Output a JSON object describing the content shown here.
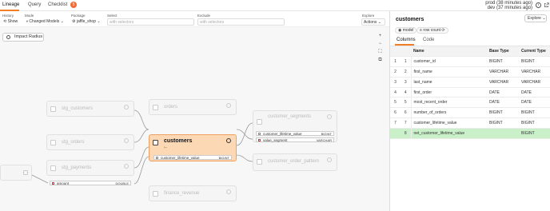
{
  "tabs": [
    "Lineage",
    "Query",
    "Checklist"
  ],
  "checklist_count": "5",
  "env": {
    "prod": "prod (38 minutes ago)",
    "dev": "dev (37 minutes ago)"
  },
  "filters": {
    "history_label": "History",
    "history_value": "Show",
    "mode_label": "Mode",
    "mode_value": "Changed Models",
    "package_label": "Package",
    "package_value": "jaffle_shop",
    "select_label": "Select",
    "select_placeholder": "with selectors",
    "exclude_label": "Exclude",
    "exclude_placeholder": "with selectors",
    "explore_label": "Explore",
    "actions_value": "Actions"
  },
  "graph": {
    "impact_radius": "Impact Radius",
    "nodes": {
      "stg_customers": "stg_customers",
      "stg_orders": "stg_orders",
      "stg_payments": "stg_payments",
      "orders": "orders",
      "customers": "customers",
      "finance_revenue": "finance_revenue",
      "customer_segments": "customer_segments",
      "customer_order_pattern": "customer_order_pattern"
    },
    "columns": {
      "amount": {
        "name": "amount",
        "type": "DOUBLE"
      },
      "customers_clv": {
        "name": "customer_lifetime_value",
        "type": "BIGINT"
      },
      "seg_clv": {
        "name": "customer_lifetime_value",
        "type": "BIGINT"
      },
      "seg_value": {
        "name": "value_segment",
        "type": "VARCHAR"
      }
    }
  },
  "panel": {
    "title": "customers",
    "explore": "Explore",
    "pill_model": "model",
    "pill_rowcount": "row count",
    "tab_columns": "Columns",
    "tab_code": "Code",
    "headers": [
      "",
      "",
      "Name",
      "Base Type",
      "Current Type"
    ],
    "rows": [
      {
        "i": "1",
        "j": "1",
        "name": "customer_id",
        "base": "BIGINT",
        "cur": "BIGINT"
      },
      {
        "i": "2",
        "j": "2",
        "name": "first_name",
        "base": "VARCHAR",
        "cur": "VARCHAR"
      },
      {
        "i": "3",
        "j": "3",
        "name": "last_name",
        "base": "VARCHAR",
        "cur": "VARCHAR"
      },
      {
        "i": "4",
        "j": "4",
        "name": "first_order",
        "base": "DATE",
        "cur": "DATE"
      },
      {
        "i": "5",
        "j": "5",
        "name": "most_recent_order",
        "base": "DATE",
        "cur": "DATE"
      },
      {
        "i": "6",
        "j": "6",
        "name": "number_of_orders",
        "base": "BIGINT",
        "cur": "BIGINT"
      },
      {
        "i": "7",
        "j": "7",
        "name": "customer_lifetime_value",
        "base": "BIGINT",
        "cur": "BIGINT"
      },
      {
        "i": "",
        "j": "8",
        "name": "net_customer_lifetime_value",
        "base": "",
        "cur": "BIGINT"
      }
    ]
  },
  "colors": {
    "accent": "#f27f27",
    "focus": "#fdd8b4",
    "added": "#c9f0c9"
  }
}
